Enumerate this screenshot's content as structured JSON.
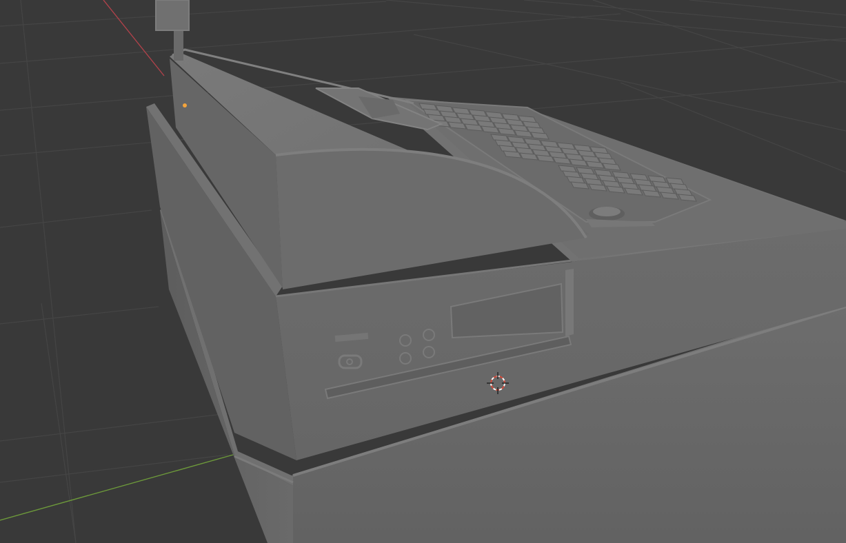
{
  "viewport": {
    "background_color": "#393939",
    "grid_color": "#454545",
    "x_axis_color": "#b0424a",
    "y_axis_color": "#6d9a3a",
    "object_color": "#6e6e6e",
    "object_origin_color": "#f3a43c",
    "cursor_color": "#d24a3a"
  },
  "scene": {
    "object": "cash-register",
    "icons": [
      "3d-cursor-icon",
      "object-origin-icon",
      "power-button-icon",
      "card-slot-icon",
      "round-button-icon"
    ]
  }
}
